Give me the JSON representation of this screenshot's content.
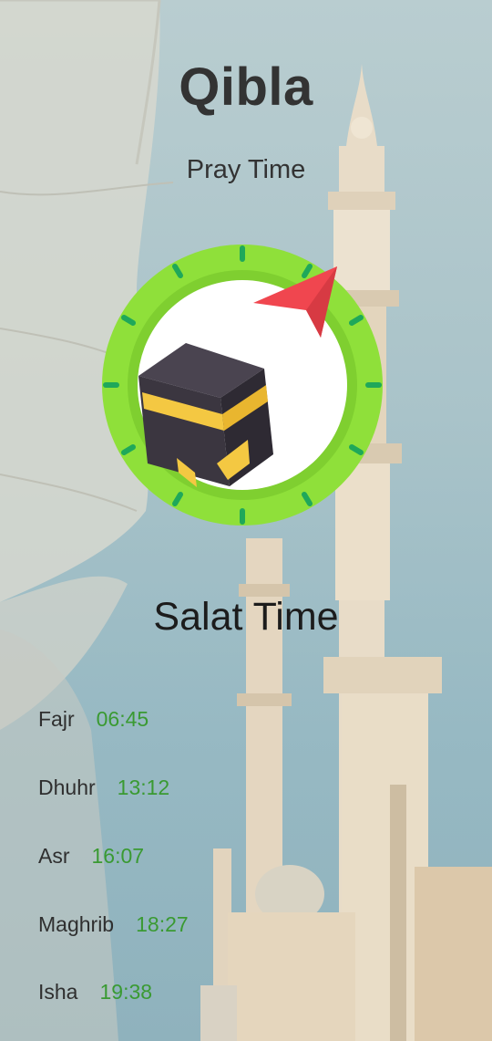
{
  "header": {
    "title": "Qibla",
    "subtitle": "Pray Time"
  },
  "compass": {
    "icon": "kaaba-compass-icon",
    "ring_color": "#8fe03a",
    "pointer_color": "#f0464f"
  },
  "salat": {
    "title": "Salat Time",
    "times": [
      {
        "name": "Fajr",
        "time": "06:45"
      },
      {
        "name": "Dhuhr",
        "time": "13:12"
      },
      {
        "name": "Asr",
        "time": "16:07"
      },
      {
        "name": "Maghrib",
        "time": "18:27"
      },
      {
        "name": "Isha",
        "time": "19:38"
      }
    ]
  },
  "colors": {
    "time_text": "#3a9a32",
    "title_text": "#333333"
  }
}
